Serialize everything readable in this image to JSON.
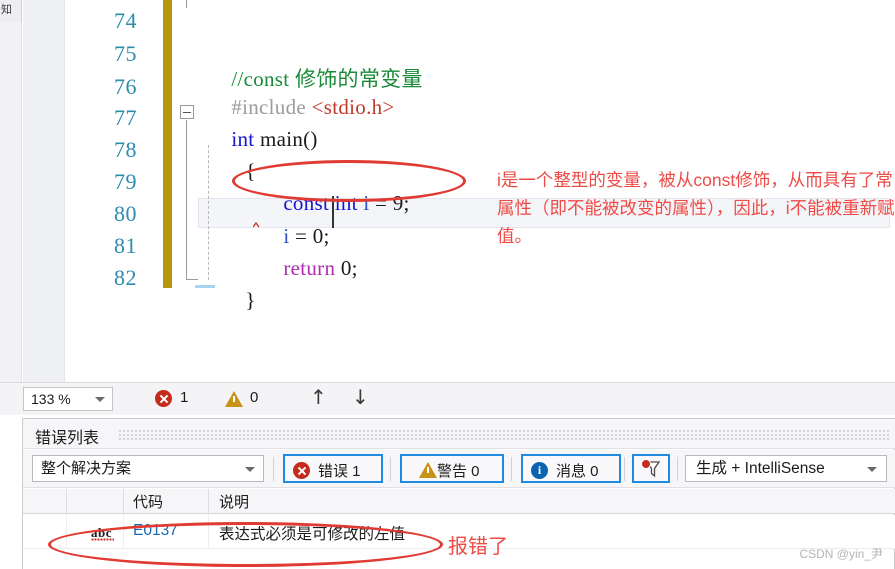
{
  "editor": {
    "tab_sliver_text": "知",
    "line_numbers": [
      "74",
      "75",
      "76",
      "77",
      "78",
      "79",
      "80",
      "81",
      "82"
    ],
    "lines": [
      {
        "num": "74",
        "tokens": []
      },
      {
        "num": "75",
        "tokens": [
          {
            "t": "//const 修饰的常变量",
            "c": "tok-comment"
          }
        ]
      },
      {
        "num": "76",
        "tokens": [
          {
            "t": "#include ",
            "c": "tok-pp"
          },
          {
            "t": "<stdio.h>",
            "c": "tok-str"
          }
        ]
      },
      {
        "num": "77",
        "tokens": [
          {
            "t": "int ",
            "c": "tok-type"
          },
          {
            "t": "main()",
            "c": "tok-plain"
          }
        ]
      },
      {
        "num": "78",
        "tokens": [
          {
            "t": "{",
            "c": "tok-plain"
          }
        ]
      },
      {
        "num": "79",
        "tokens": [
          {
            "t": "const int ",
            "c": "tok-kw"
          },
          {
            "t": "i",
            "c": "tok-var"
          },
          {
            "t": " = 9;",
            "c": "tok-plain"
          }
        ]
      },
      {
        "num": "80",
        "tokens": [
          {
            "t": "i",
            "c": "tok-var"
          },
          {
            "t": " = 0;",
            "c": "tok-plain"
          }
        ]
      },
      {
        "num": "81",
        "tokens": [
          {
            "t": "return",
            "c": "tok-ret"
          },
          {
            "t": " 0;",
            "c": "tok-plain"
          }
        ]
      },
      {
        "num": "82",
        "tokens": [
          {
            "t": "}",
            "c": "tok-plain"
          }
        ]
      }
    ],
    "line_74_text": "",
    "line_75_text": "//const 修饰的常变量",
    "line_76_pp": "#include ",
    "line_76_hdr": "<stdio.h>",
    "line_77_kw": "int ",
    "line_77_rest": "main()",
    "line_78_text": "{",
    "line_79_kw": "const int ",
    "line_79_var": "i",
    "line_79_rest": " = 9;",
    "line_80_var": "i",
    "line_80_rest": " = 0;",
    "line_81_kw": "return",
    "line_81_rest": " 0;",
    "line_82_text": "}",
    "change_bar_color": "#b8960c",
    "line_number_color": "#2b8cb0"
  },
  "annotations": {
    "code_note": "i是一个整型的变量，被从const修饰，从而具有了常属性（即不能被改变的属性），因此，i不能被重新赋值。",
    "row_note": "报错了",
    "note_color": "#ef4b46",
    "ellipse_color": "#e03a32"
  },
  "status_bar": {
    "zoom_value": "133 %",
    "error_count": "1",
    "warning_count": "0",
    "nav_prev_icon": "arrow-up-icon",
    "nav_next_icon": "arrow-down-icon",
    "arrow_up": "↑",
    "arrow_down": "↓"
  },
  "error_panel": {
    "title": "错误列表",
    "scope_selector": "整个解决方案",
    "filters": [
      {
        "label": "错误 1",
        "icon": "error-icon"
      },
      {
        "label": "警告 0",
        "icon": "warning-icon"
      },
      {
        "label": "消息 0",
        "icon": "info-icon"
      }
    ],
    "filter_error_label": "错误 1",
    "filter_warning_label": "警告 0",
    "filter_message_label": "消息 0",
    "funnel_icon": "filter-funnel-icon",
    "build_selector": "生成 + IntelliSense",
    "columns": [
      "",
      "",
      "代码",
      "说明"
    ],
    "col_code": "代码",
    "col_desc": "说明",
    "rows": [
      {
        "icon": "abc-spellcheck-icon",
        "icon_text": "abc",
        "code": "E0137",
        "description": "表达式必须是可修改的左值"
      }
    ],
    "row0_icon_text": "abc",
    "row0_code": "E0137",
    "row0_desc": "表达式必须是可修改的左值",
    "accent_blue": "#1f8ae0"
  },
  "watermark": "CSDN @yin_尹"
}
